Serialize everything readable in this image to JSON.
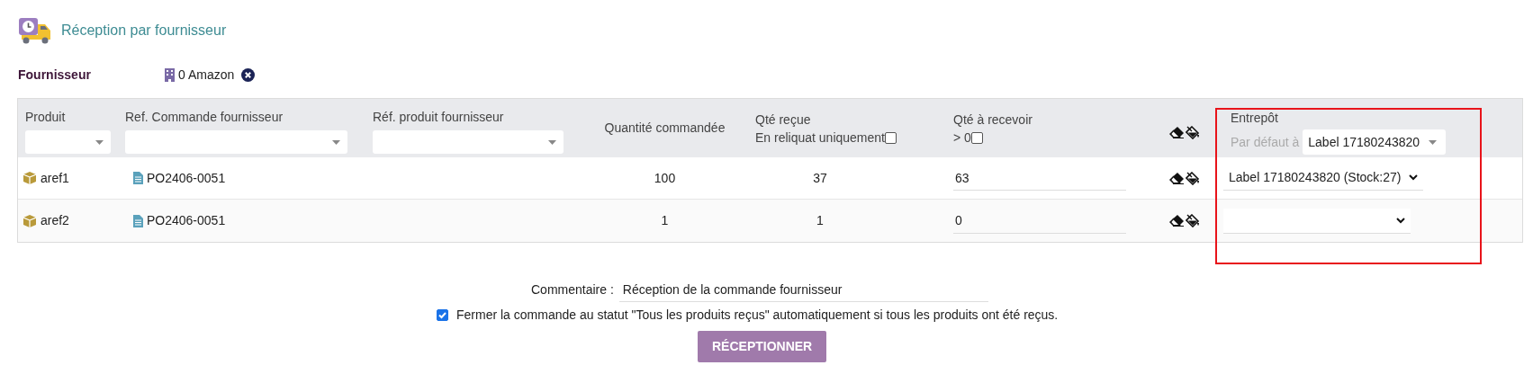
{
  "header": {
    "title": "Réception par fournisseur"
  },
  "supplier": {
    "label": "Fournisseur",
    "value": "0 Amazon"
  },
  "table": {
    "columns": [
      {
        "kind": "select",
        "label": "Produit"
      },
      {
        "kind": "select",
        "label": "Ref. Commande fournisseur"
      },
      {
        "kind": "select",
        "label": "Réf. produit fournisseur"
      },
      {
        "kind": "text",
        "label": "Quantité commandée"
      },
      {
        "kind": "checkbox",
        "label": "Qté reçue",
        "sublabel": "En reliquat uniquement",
        "checked": false
      },
      {
        "kind": "checkbox",
        "label": "Qté à recevoir",
        "sublabel": "> 0",
        "checked": false
      },
      {
        "kind": "icons"
      },
      {
        "kind": "default",
        "label": "Entrepôt",
        "default_label": "Par défaut à",
        "default_value": "Label 17180243820"
      }
    ],
    "rows": [
      {
        "product": "aref1",
        "order_ref": "PO2406-0051",
        "ordered": "100",
        "received": "37",
        "to_receive": "63",
        "warehouse": "Label 17180243820 (Stock:27)"
      },
      {
        "product": "aref2",
        "order_ref": "PO2406-0051",
        "ordered": "1",
        "received": "1",
        "to_receive": "0"
      }
    ]
  },
  "comment": {
    "label": "Commentaire :",
    "value": "Réception de la commande fournisseur"
  },
  "close_order": {
    "checked": true,
    "label": "Fermer la commande au statut \"Tous les produits reçus\" automatiquement si tous les produits ont été reçus."
  },
  "submit": "RÉCEPTIONNER"
}
